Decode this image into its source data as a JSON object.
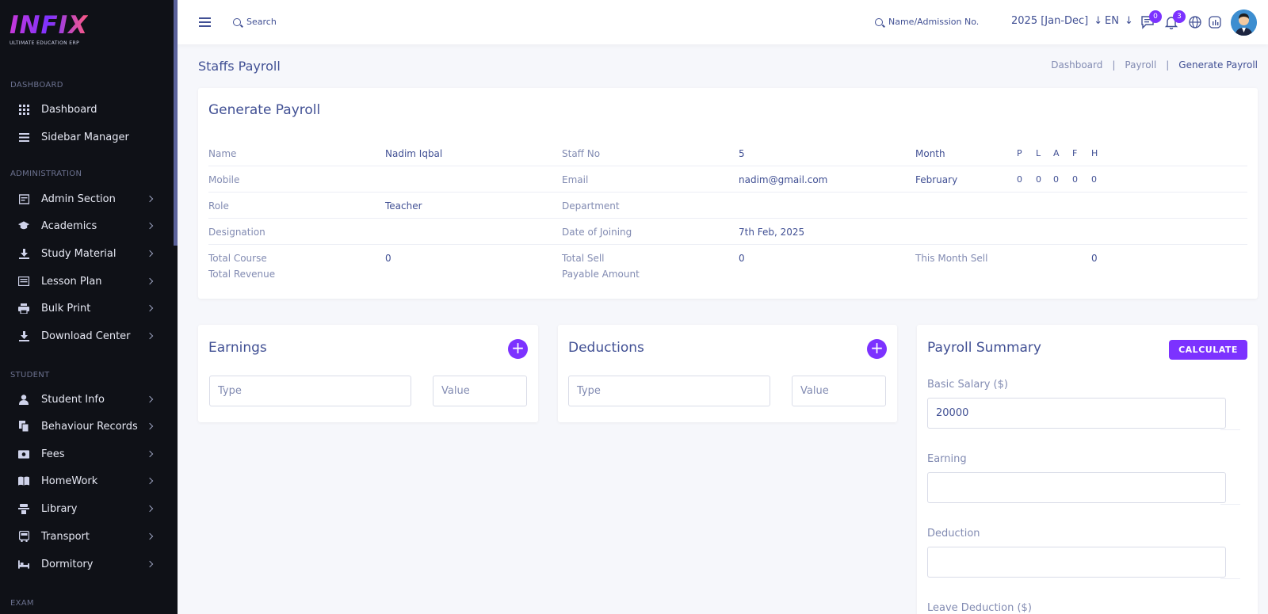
{
  "sidebar": {
    "logo": {
      "text": "INFIX",
      "subtitle": "ULTIMATE EDUCATION ERP"
    },
    "sections": [
      {
        "title": "DASHBOARD",
        "items": [
          {
            "label": "Dashboard",
            "icon": "grid-icon",
            "chevron": false
          },
          {
            "label": "Sidebar Manager",
            "icon": "menu-icon",
            "chevron": false
          }
        ]
      },
      {
        "title": "ADMINISTRATION",
        "items": [
          {
            "label": "Admin Section",
            "icon": "admin-icon",
            "chevron": true
          },
          {
            "label": "Academics",
            "icon": "graduation-cap-icon",
            "chevron": true
          },
          {
            "label": "Study Material",
            "icon": "download-icon",
            "chevron": true
          },
          {
            "label": "Lesson Plan",
            "icon": "lesson-icon",
            "chevron": true
          },
          {
            "label": "Bulk Print",
            "icon": "printer-icon",
            "chevron": true
          },
          {
            "label": "Download Center",
            "icon": "download-icon",
            "chevron": true
          }
        ]
      },
      {
        "title": "STUDENT",
        "items": [
          {
            "label": "Student Info",
            "icon": "user-icon",
            "chevron": true
          },
          {
            "label": "Behaviour Records",
            "icon": "records-icon",
            "chevron": true
          },
          {
            "label": "Fees",
            "icon": "money-icon",
            "chevron": true
          },
          {
            "label": "HomeWork",
            "icon": "book-icon",
            "chevron": true
          },
          {
            "label": "Library",
            "icon": "library-icon",
            "chevron": true
          },
          {
            "label": "Transport",
            "icon": "bus-icon",
            "chevron": true
          },
          {
            "label": "Dormitory",
            "icon": "bed-icon",
            "chevron": true
          }
        ]
      },
      {
        "title": "EXAM",
        "items": []
      }
    ]
  },
  "topbar": {
    "search_label": "Search",
    "student_search_label": "Name/Admission No.",
    "session": "2025 [Jan-Dec]",
    "language": "EN",
    "messages_count": "0",
    "notifications_count": "3"
  },
  "page": {
    "title": "Staffs Payroll",
    "breadcrumb": [
      "Dashboard",
      "Payroll",
      "Generate Payroll"
    ]
  },
  "generate": {
    "title": "Generate Payroll",
    "name_label": "Name",
    "name": "Nadim Iqbal",
    "staff_no_label": "Staff No",
    "staff_no": "5",
    "month_label": "Month",
    "month": "February",
    "attendance_headers": [
      "P",
      "L",
      "A",
      "F",
      "H"
    ],
    "attendance_values": [
      "0",
      "0",
      "0",
      "0",
      "0"
    ],
    "mobile_label": "Mobile",
    "mobile": "",
    "email_label": "Email",
    "email": "nadim@gmail.com",
    "role_label": "Role",
    "role": "Teacher",
    "department_label": "Department",
    "department": "",
    "designation_label": "Designation",
    "designation": "",
    "doj_label": "Date of Joining",
    "doj": "7th Feb, 2025",
    "total_course_label": "Total Course",
    "total_course": "0",
    "total_revenue_label": "Total Revenue",
    "total_sell_label": "Total Sell",
    "total_sell": "0",
    "payable_label": "Payable Amount",
    "this_month_sell_label": "This Month Sell",
    "this_month_sell": "0"
  },
  "earnings": {
    "title": "Earnings",
    "type_placeholder": "Type",
    "value_placeholder": "Value"
  },
  "deductions": {
    "title": "Deductions",
    "type_placeholder": "Type",
    "value_placeholder": "Value"
  },
  "summary": {
    "title": "Payroll Summary",
    "calculate_label": "CALCULATE",
    "basic_salary_label": "Basic Salary ($)",
    "basic_salary": "20000",
    "earning_label": "Earning",
    "earning": "",
    "deduction_label": "Deduction",
    "deduction": "",
    "leave_deduction_label": "Leave Deduction ($)"
  },
  "colors": {
    "accent": "#7c32ff",
    "text": "#415094",
    "muted": "#828bb2",
    "sidebar_bg": "#0f1117"
  }
}
